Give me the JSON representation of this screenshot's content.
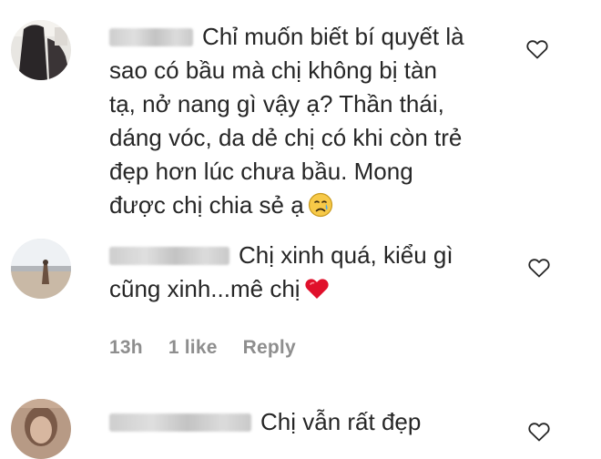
{
  "comments": [
    {
      "text_before": "Chỉ muốn biết bí quyết là sao có bầu mà chị không bị tàn tạ, nở nang gì vậy ạ? Thần thái, dáng vóc, da dẻ chị có khi còn trẻ đẹp hơn lúc chưa bầu. Mong được chị chia sẻ ạ",
      "lines": [
        "Chỉ muốn biết bí quyết là",
        "sao có bầu mà chị không bị tàn",
        "tạ, nở nang gì vậy ạ? Thần thái,",
        "dáng vóc, da dẻ chị có khi còn trẻ",
        "đẹp hơn lúc chưa bầu. Mong",
        "được chị chia sẻ ạ"
      ],
      "emoji": "crying-face-icon",
      "heart_icon": "heart-outline-icon"
    },
    {
      "lines": [
        "Chị xinh quá, kiểu gì",
        "cũng xinh...mê chị"
      ],
      "emoji": "red-heart-icon",
      "heart_icon": "heart-outline-icon",
      "meta": {
        "time": "13h",
        "likes": "1 like",
        "reply": "Reply"
      }
    },
    {
      "lines": [
        "Chị vẫn rất đẹp"
      ],
      "heart_icon": "heart-outline-icon"
    }
  ],
  "colors": {
    "text": "#262626",
    "meta": "#8e8e8e",
    "heart_red": "#e0102b"
  }
}
